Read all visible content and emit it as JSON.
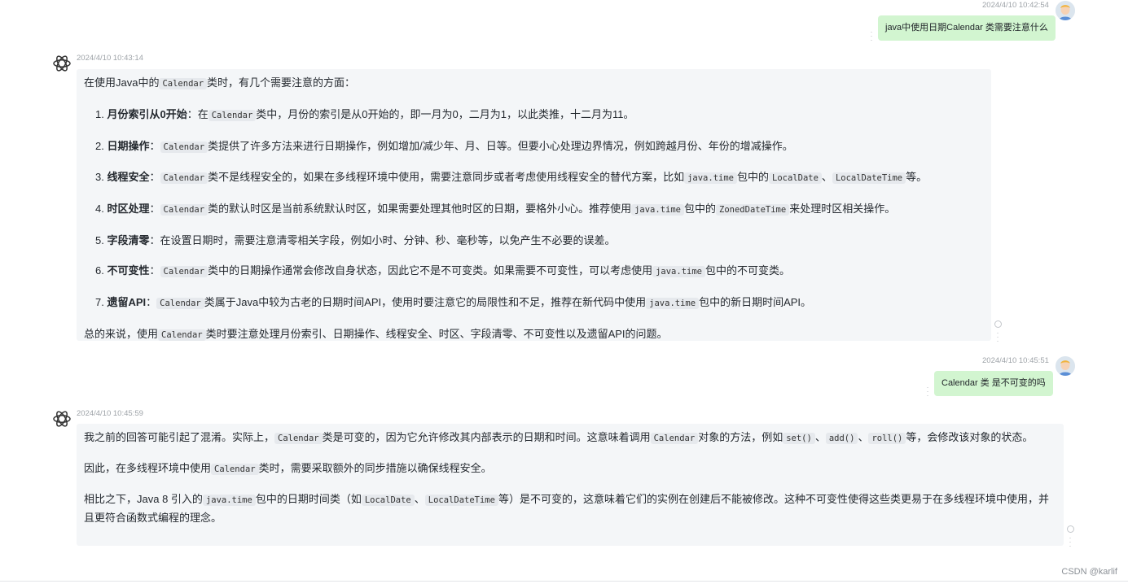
{
  "messages": {
    "m1": {
      "timestamp": "2024/4/10 10:42:54",
      "text": "java中使用日期Calendar 类需要注意什么"
    },
    "m2": {
      "timestamp": "2024/4/10 10:43:14",
      "intro": [
        "在使用Java中的",
        "Calendar",
        "类时，有几个需要注意的方面："
      ],
      "items": [
        {
          "num": "1.",
          "title": "月份索引从0开始",
          "parts": [
            "：在",
            "Calendar",
            "类中，月份的索引是从0开始的，即一月为0，二月为1，以此类推，十二月为11。"
          ]
        },
        {
          "num": "2.",
          "title": "日期操作",
          "parts": [
            "：",
            "Calendar",
            "类提供了许多方法来进行日期操作，例如增加/减少年、月、日等。但要小心处理边界情况，例如跨越月份、年份的增减操作。"
          ]
        },
        {
          "num": "3.",
          "title": "线程安全",
          "parts": [
            "：",
            "Calendar",
            "类不是线程安全的，如果在多线程环境中使用，需要注意同步或者考虑使用线程安全的替代方案，比如",
            "java.time",
            "包中的",
            "LocalDate",
            "、",
            "LocalDateTime",
            "等。"
          ]
        },
        {
          "num": "4.",
          "title": "时区处理",
          "parts": [
            "：",
            "Calendar",
            "类的默认时区是当前系统默认时区，如果需要处理其他时区的日期，要格外小心。推荐使用",
            "java.time",
            "包中的",
            "ZonedDateTime",
            "来处理时区相关操作。"
          ]
        },
        {
          "num": "5.",
          "title": "字段清零",
          "parts": [
            "：在设置日期时，需要注意清零相关字段，例如小时、分钟、秒、毫秒等，以免产生不必要的误差。"
          ]
        },
        {
          "num": "6.",
          "title": "不可变性",
          "parts": [
            "：",
            "Calendar",
            "类中的日期操作通常会修改自身状态，因此它不是不可变类。如果需要不可变性，可以考虑使用",
            "java.time",
            "包中的不可变类。"
          ]
        },
        {
          "num": "7.",
          "title": "遗留API",
          "parts": [
            "：",
            "Calendar",
            "类属于Java中较为古老的日期时间API，使用时要注意它的局限性和不足，推荐在新代码中使用",
            "java.time",
            "包中的新日期时间API。"
          ]
        }
      ],
      "summary": [
        "总的来说，使用",
        "Calendar",
        "类时要注意处理月份索引、日期操作、线程安全、时区、字段清零、不可变性以及遗留API的问题。"
      ]
    },
    "m3": {
      "timestamp": "2024/4/10 10:45:51",
      "text": "Calendar 类 是不可变的吗"
    },
    "m4": {
      "timestamp": "2024/4/10 10:45:59",
      "p1": [
        "我之前的回答可能引起了混淆。实际上，",
        "Calendar",
        "类是可变的，因为它允许修改其内部表示的日期和时间。这意味着调用",
        "Calendar",
        "对象的方法，例如",
        "set()",
        "、",
        "add()",
        "、",
        "roll()",
        "等，会修改该对象的状态。"
      ],
      "p2": [
        "因此，在多线程环境中使用",
        "Calendar",
        "类时，需要采取额外的同步措施以确保线程安全。"
      ],
      "p3": [
        "相比之下，Java 8 引入的",
        "java.time",
        "包中的日期时间类（如",
        "LocalDate",
        "、",
        "LocalDateTime",
        "等）是不可变的，这意味着它们的实例在创建后不能被修改。这种不可变性使得这些类更易于在多线程环境中使用，并且更符合函数式编程的理念。"
      ]
    }
  },
  "watermark": "CSDN @karlif",
  "icons": {
    "user_avatar": "user-avatar-icon",
    "bot_avatar": "openai-logo-icon",
    "more": "more-dots-icon",
    "status": "status-circle-icon"
  }
}
